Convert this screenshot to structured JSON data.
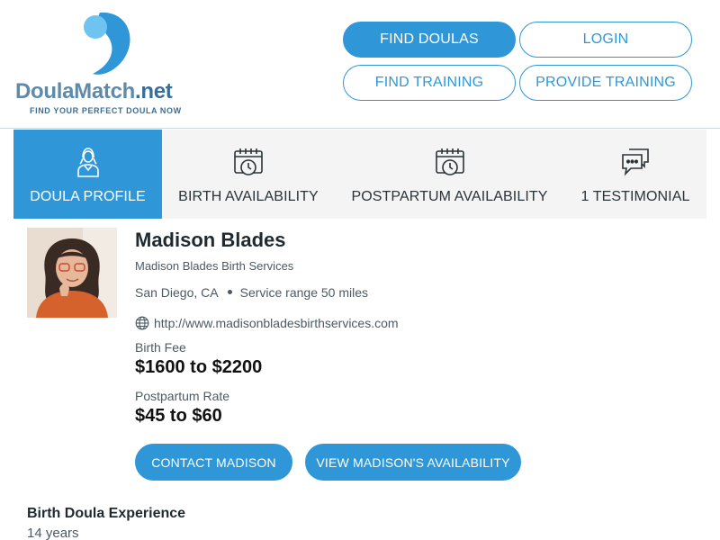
{
  "logo": {
    "name_main": "DoulaMatch",
    "name_suffix": ".net",
    "tagline": "FIND YOUR PERFECT DOULA NOW",
    "colors": {
      "light": "#6ec3f0",
      "dark": "#2f97d8"
    }
  },
  "nav": {
    "find_doulas": "FIND DOULAS",
    "login": "LOGIN",
    "find_training": "FIND TRAINING",
    "provide_training": "PROVIDE TRAINING"
  },
  "tabs": [
    {
      "label": "DOULA PROFILE",
      "icon": "doula-person-icon",
      "active": true
    },
    {
      "label": "BIRTH AVAILABILITY",
      "icon": "calendar-clock-icon",
      "active": false
    },
    {
      "label": "POSTPARTUM AVAILABILITY",
      "icon": "calendar-clock-icon",
      "active": false
    },
    {
      "label": "1 TESTIMONIAL",
      "icon": "chat-bubbles-icon",
      "active": false
    }
  ],
  "profile": {
    "name": "Madison Blades",
    "business": "Madison Blades Birth Services",
    "city": "San Diego, CA",
    "service_range": "Service range 50 miles",
    "website": "http://www.madisonbladesbirthservices.com",
    "birth_fee_label": "Birth Fee",
    "birth_fee": "$1600 to $2200",
    "postpartum_label": "Postpartum Rate",
    "postpartum_rate": "$45 to $60",
    "contact_button": "CONTACT MADISON",
    "availability_button": "VIEW MADISON'S AVAILABILITY"
  },
  "experience": {
    "title": "Birth Doula Experience",
    "value": "14 years"
  },
  "colors": {
    "accent": "#2f97d8",
    "tab_bg": "#f4f4f4"
  }
}
